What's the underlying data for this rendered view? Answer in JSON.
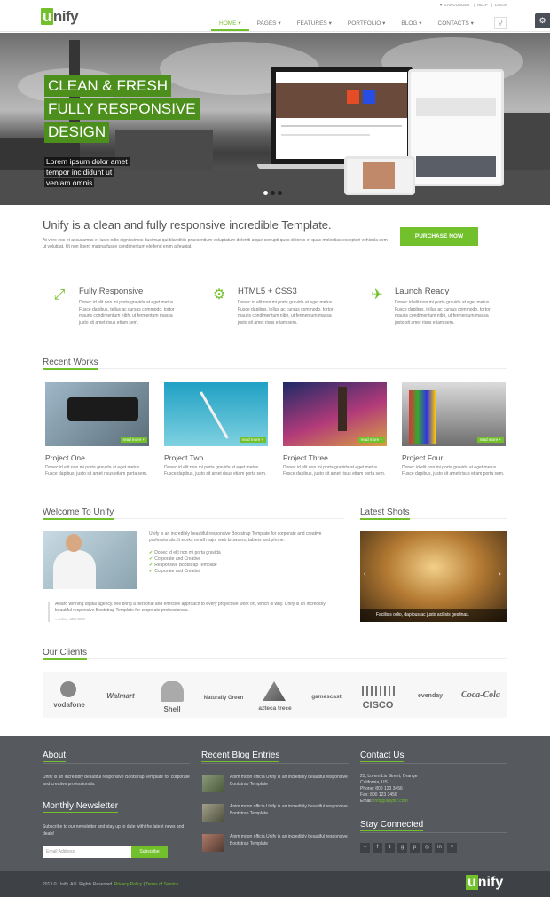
{
  "header": {
    "logo_mark": "u",
    "logo_rest": "nify",
    "top_links": [
      "LANGUAGES",
      "HELP",
      "LOGIN"
    ],
    "nav": [
      "HOME",
      "PAGES",
      "FEATURES",
      "PORTFOLIO",
      "BLOG",
      "CONTACTS"
    ],
    "active_nav": "HOME"
  },
  "hero": {
    "lines": [
      "CLEAN & FRESH",
      "FULLY RESPONSIVE",
      "DESIGN"
    ],
    "sub": [
      "Lorem ipsum dolor amet",
      "tempor incididunt ut",
      "veniam omnis"
    ]
  },
  "purchase": {
    "title": "Unify is a clean and fully responsive incredible Template.",
    "text": "At vero eos et accusamus et iusto odio dignissimos ducimus qui blanditiis praesentium voluptatum deleniti atque corrupti quos dolores et quas molestias excepturi vehicula sem ut volutpat. Ut non libero magna fusce condimentum eleifend enim a feugiat.",
    "button": "PURCHASE NOW"
  },
  "features": [
    {
      "icon": "resize-icon",
      "title": "Fully Responsive",
      "text": "Donec id elit non mi porta gravida at eget metus. Fusce dapibus, tellus ac cursus commodo, tortor mauris condimentum nibh, ut fermentum massa justo sit amet risus etiam sem."
    },
    {
      "icon": "gears-icon",
      "title": "HTML5 + CSS3",
      "text": "Donec id elit non mi porta gravida at eget metus. Fusce dapibus, tellus ac cursus commodo, tortor mauris condimentum nibh, ut fermentum massa justo sit amet risus etiam sem."
    },
    {
      "icon": "plane-icon",
      "title": "Launch Ready",
      "text": "Donec id elit non mi porta gravida at eget metus. Fusce dapibus, tellus ac cursus commodo, tortor mauris condimentum nibh, ut fermentum massa justo sit amet risus etiam sem."
    }
  ],
  "recent_works": {
    "heading": "Recent Works",
    "read_more": "read more +",
    "items": [
      {
        "title": "Project One",
        "text": "Donec id elit non mi porta gravida at eget metus. Fusce dapibus, justo sit amet risus etiam porta sem."
      },
      {
        "title": "Project Two",
        "text": "Donec id elit non mi porta gravida at eget metus. Fusce dapibus, justo sit amet risus etiam porta sem."
      },
      {
        "title": "Project Three",
        "text": "Donec id elit non mi porta gravida at eget metus. Fusce dapibus, justo sit amet risus etiam porta sem."
      },
      {
        "title": "Project Four",
        "text": "Donec id elit non mi porta gravida at eget metus. Fusce dapibus, justo sit amet risus etiam porta sem."
      }
    ]
  },
  "welcome": {
    "heading": "Welcome To Unify",
    "intro": "Unify is an incredibly beautiful responsive Bootstrap Template for corporate and creative professionals. It works on all major web browsers, tablets and phone.",
    "checks": [
      "Donec id elit non mi porta gravida",
      "Corporate and Creative",
      "Responsive Bootstrap Template",
      "Corporate and Creative"
    ],
    "quote": "Award winning digital agency. We bring a personal and effective approach to every project we work on, which is why. Unify is an incredibly beautiful responsive Bootstrap Template for corporate professionals.",
    "quote_author": "— CEO, Jack Bour"
  },
  "latest_shots": {
    "heading": "Latest Shots",
    "caption": "Facilisis odio, dapibus ac justo acilisis gestinas."
  },
  "clients": {
    "heading": "Our Clients",
    "logos": [
      "vodafone",
      "Walmart",
      "Shell",
      "Naturally Green",
      "azteca trece",
      "gamescast",
      "CISCO",
      "evenday",
      "Coca-Cola"
    ]
  },
  "footer": {
    "about_heading": "About",
    "about_text": "Unify is an incredibly beautiful responsive Bootstrap Template for corporate and creative professionals.",
    "newsletter_heading": "Monthly Newsletter",
    "newsletter_text": "Subscribe to our newsletter and stay up to date with the latest news and deals!",
    "email_placeholder": "Email Address",
    "subscribe": "Subscribe",
    "blog_heading": "Recent Blog Entries",
    "blog_entries": [
      "Anim moon officia Unify is an incredibly beautiful responsive Bootstrap Template",
      "Anim moon officia Unify is an incredibly beautiful responsive Bootstrap Template",
      "Anim moon officia Unify is an incredibly beautiful responsive Bootstrap Template"
    ],
    "contact_heading": "Contact Us",
    "contact_lines": [
      "25, Lorem Lis Street, Orange",
      "California, US",
      "Phone: 800 123 3456",
      "Fax: 800 123 3456"
    ],
    "contact_email_label": "Email:",
    "contact_email": "info@anybiz.com",
    "stay_heading": "Stay Connected",
    "social": [
      "rss-icon",
      "facebook-icon",
      "twitter-icon",
      "google-plus-icon",
      "pinterest-icon",
      "dribbble-icon",
      "linkedin-icon",
      "vimeo-icon"
    ]
  },
  "copyright": {
    "text": "2013 © Unify. ALL Rights Reserved.",
    "privacy": "Privacy Policy",
    "sep": "|",
    "terms": "Terms of Service",
    "logo_mark": "u",
    "logo_rest": "nify"
  },
  "colors": {
    "accent": "#72c02c",
    "footer": "#56595e",
    "copyright": "#3e4146"
  }
}
